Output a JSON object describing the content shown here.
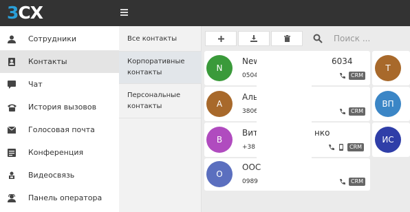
{
  "app": {
    "logo_prefix": "3",
    "logo_suffix": "CX"
  },
  "sidebar": {
    "items": [
      {
        "label": "Сотрудники",
        "icon": "user-icon"
      },
      {
        "label": "Контакты",
        "icon": "contacts-icon",
        "active": true
      },
      {
        "label": "Чат",
        "icon": "chat-icon"
      },
      {
        "label": "История вызовов",
        "icon": "phone-history-icon"
      },
      {
        "label": "Голосовая почта",
        "icon": "envelope-icon"
      },
      {
        "label": "Конференция",
        "icon": "conference-icon"
      },
      {
        "label": "Видеосвязь",
        "icon": "video-icon"
      },
      {
        "label": "Панель оператора",
        "icon": "operator-panel-icon"
      }
    ]
  },
  "subnav": {
    "items": [
      {
        "label": "Все контакты"
      },
      {
        "label": "Корпоративные контакты",
        "active": true
      },
      {
        "label": "Персональные контакты"
      }
    ]
  },
  "toolbar": {
    "add_icon": "plus-icon",
    "import_icon": "download-icon",
    "delete_icon": "trash-icon",
    "search_placeholder": "Поиск ..."
  },
  "contacts": [
    {
      "initial": "N",
      "color": "#3a9a3a",
      "name_start": "New ",
      "name_end": "6034",
      "phone": "0504",
      "crm": "CRM"
    },
    {
      "initial": "A",
      "color": "#a8692b",
      "name_start": "Аль",
      "phone": "3806",
      "crm": "CRM"
    },
    {
      "initial": "В",
      "color": "#b04bbf",
      "name_start": "Вит",
      "name_end": "нко",
      "phone": "+38",
      "crm": "CRM"
    },
    {
      "initial": "О",
      "color": "#5b6fbf",
      "name_start": "ООС",
      "phone": "0989",
      "crm": "CRM"
    }
  ],
  "side_contacts": [
    {
      "initial": "T",
      "color": "#a8692b"
    },
    {
      "initial": "ВП",
      "color": "#3b86c6"
    },
    {
      "initial": "ИС",
      "color": "#2f3ea8"
    }
  ]
}
